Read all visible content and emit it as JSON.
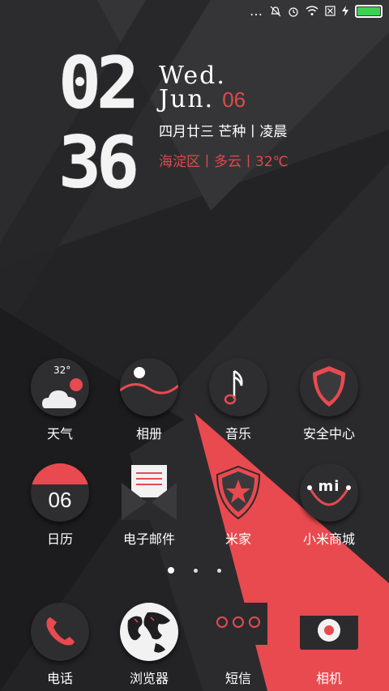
{
  "status_bar": {
    "more_icon": "…",
    "battery_color": "#39d353"
  },
  "clock": {
    "hours": "02",
    "minutes": "36"
  },
  "date": {
    "weekday": "Wed.",
    "month": "Jun.",
    "day": "06"
  },
  "lunar_line": "四月廿三 芒种丨凌晨",
  "weather_line": "海淀区丨多云丨32℃",
  "weather_icon_temp": "32°",
  "apps": [
    {
      "label": "天气"
    },
    {
      "label": "相册"
    },
    {
      "label": "音乐"
    },
    {
      "label": "安全中心"
    },
    {
      "label": "日历",
      "calendar_day": "06"
    },
    {
      "label": "电子邮件"
    },
    {
      "label": "米家"
    },
    {
      "label": "小米商城",
      "logo_text": "mi"
    }
  ],
  "dock": [
    {
      "label": "电话"
    },
    {
      "label": "浏览器"
    },
    {
      "label": "短信"
    },
    {
      "label": "相机"
    }
  ],
  "colors": {
    "accent": "#e84a4f",
    "dark_icon": "#2e2e31"
  }
}
